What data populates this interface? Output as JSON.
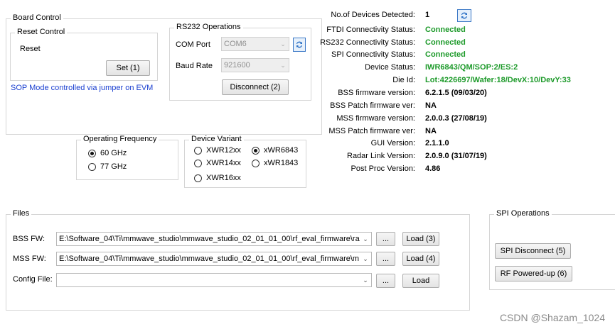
{
  "board_control": {
    "title": "Board Control",
    "reset_control": {
      "title": "Reset Control",
      "reset_label": "Reset",
      "set_button": "Set (1)"
    },
    "sop_note": "SOP Mode controlled via jumper on EVM"
  },
  "rs232": {
    "title": "RS232 Operations",
    "com_port_label": "COM Port",
    "com_port_value": "COM6",
    "baud_rate_label": "Baud Rate",
    "baud_rate_value": "921600",
    "disconnect_button": "Disconnect (2)"
  },
  "operating_frequency": {
    "title": "Operating Frequency",
    "options": [
      "60 GHz",
      "77 GHz"
    ],
    "selected": "60 GHz"
  },
  "device_variant": {
    "title": "Device Variant",
    "options": [
      "XWR12xx",
      "xWR6843",
      "XWR14xx",
      "xWR1843",
      "XWR16xx"
    ],
    "selected": "xWR6843"
  },
  "status": [
    {
      "label": "No.of Devices Detected:",
      "value": "1",
      "color": "#000000"
    },
    {
      "label": "FTDI Connectivity Status:",
      "value": "Connected",
      "color": "#1d9a2a"
    },
    {
      "label": "RS232 Connectivity Status:",
      "value": "Connected",
      "color": "#1d9a2a"
    },
    {
      "label": "SPI Connectivity Status:",
      "value": "Connected",
      "color": "#1d9a2a"
    },
    {
      "label": "Device Status:",
      "value": "IWR6843/QM/SOP:2/ES:2",
      "color": "#1d9a2a"
    },
    {
      "label": "Die Id:",
      "value": "Lot:4226697/Wafer:18/DevX:10/DevY:33",
      "color": "#1d9a2a"
    },
    {
      "label": "BSS firmware version:",
      "value": "6.2.1.5 (09/03/20)",
      "color": "#000000"
    },
    {
      "label": "BSS Patch firmware ver:",
      "value": "NA",
      "color": "#000000"
    },
    {
      "label": "MSS firmware version:",
      "value": "2.0.0.3 (27/08/19)",
      "color": "#000000"
    },
    {
      "label": "MSS Patch firmware ver:",
      "value": "NA",
      "color": "#000000"
    },
    {
      "label": "GUI Version:",
      "value": "2.1.1.0",
      "color": "#000000"
    },
    {
      "label": "Radar Link Version:",
      "value": "2.0.9.0 (31/07/19)",
      "color": "#000000"
    },
    {
      "label": "Post Proc Version:",
      "value": "4.86",
      "color": "#000000"
    }
  ],
  "files": {
    "title": "Files",
    "bss_label": "BSS FW:",
    "bss_value": "E:\\Software_04\\Ti\\mmwave_studio\\mmwave_studio_02_01_01_00\\rf_eval_firmware\\ra",
    "bss_load": "Load (3)",
    "mss_label": "MSS FW:",
    "mss_value": "E:\\Software_04\\Ti\\mmwave_studio\\mmwave_studio_02_01_01_00\\rf_eval_firmware\\m",
    "mss_load": "Load (4)",
    "config_label": "Config File:",
    "config_value": "",
    "config_load": "Load",
    "browse_label": "..."
  },
  "spi": {
    "title": "SPI Operations",
    "disconnect_button": "SPI Disconnect (5)",
    "powerup_button": "RF Powered-up (6)"
  },
  "watermark": "CSDN @Shazam_1024"
}
